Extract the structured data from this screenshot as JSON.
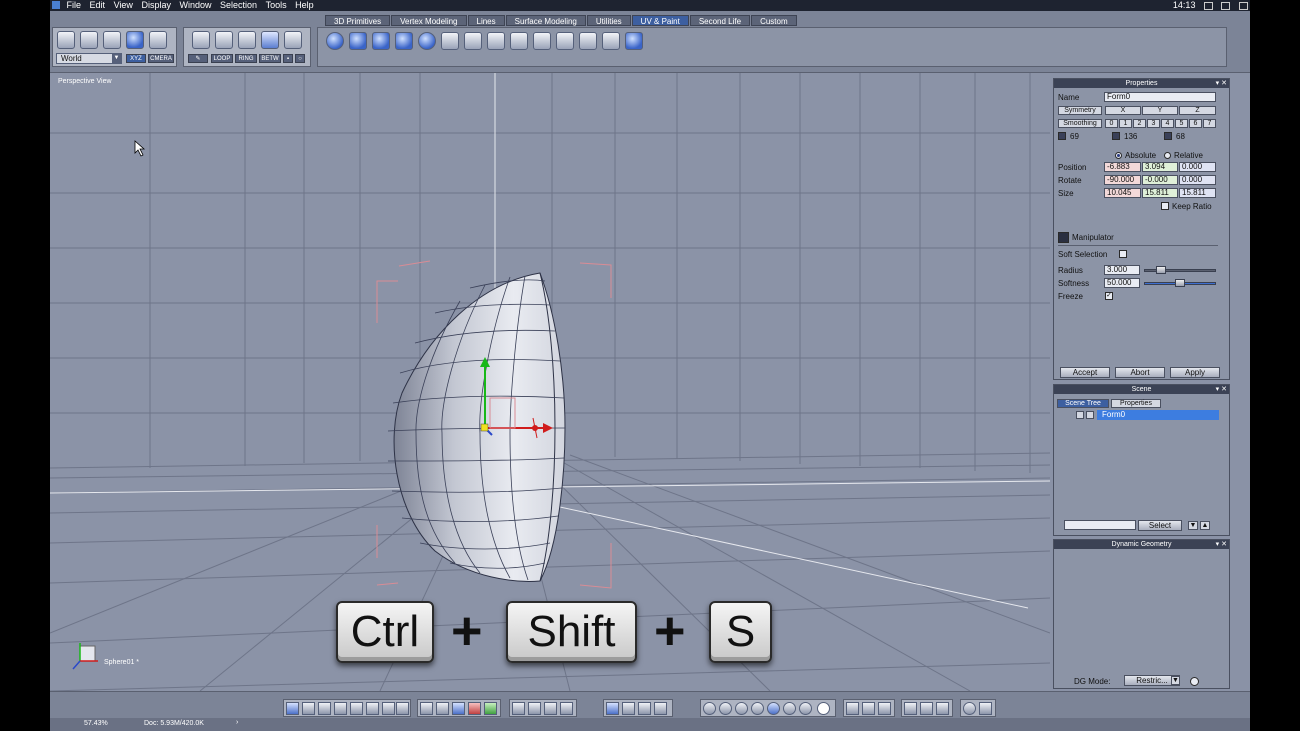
{
  "menubar": {
    "items": [
      "File",
      "Edit",
      "View",
      "Display",
      "Window",
      "Selection",
      "Tools",
      "Help"
    ],
    "clock": "14:13"
  },
  "toolbar": {
    "tabs": [
      "3D Primitives",
      "Vertex Modeling",
      "Lines",
      "Surface Modeling",
      "Utilities",
      "UV & Paint",
      "Second Life",
      "Custom"
    ],
    "active_tab": "UV & Paint",
    "coord_space": "World",
    "xyz_label": "XYZ",
    "camera_label": "CMERA",
    "loop_label": "LOOP",
    "ring_label": "RING",
    "betw_label": "BETW"
  },
  "viewport": {
    "label": "Perspective View",
    "object_label": "Sphere01 *"
  },
  "shortcut": {
    "key1": "Ctrl",
    "plus1": "+",
    "key2": "Shift",
    "plus2": "+",
    "key3": "S"
  },
  "properties": {
    "title": "Properties",
    "name_label": "Name",
    "name_value": "Form0",
    "symmetry_label": "Symmetry",
    "sym_axes": [
      "X",
      "Y",
      "Z"
    ],
    "smoothing_label": "Smoothing",
    "smoothing_levels": [
      "0",
      "1",
      "2",
      "3",
      "4",
      "5",
      "6",
      "7"
    ],
    "counts": [
      "69",
      "136",
      "68"
    ],
    "absolute_label": "Absolute",
    "relative_label": "Relative",
    "position_label": "Position",
    "position": [
      "-6.883",
      "3.094",
      "0.000"
    ],
    "rotate_label": "Rotate",
    "rotate": [
      "-90.000",
      "-0.000",
      "0.000"
    ],
    "size_label": "Size",
    "size": [
      "10.045",
      "15.811",
      "15.811"
    ],
    "keep_ratio_label": "Keep Ratio",
    "manipulator_label": "Manipulator",
    "soft_selection_label": "Soft Selection",
    "radius_label": "Radius",
    "radius_value": "3.000",
    "radius_level": 0.2,
    "softness_label": "Softness",
    "softness_value": "50.000",
    "softness_level": 0.5,
    "freeze_label": "Freeze",
    "freeze_mark": "✓",
    "accept_label": "Accept",
    "abort_label": "Abort",
    "apply_label": "Apply"
  },
  "scene": {
    "title": "Scene",
    "tabs": [
      "Scene Tree",
      "Properties"
    ],
    "items": [
      "Form0"
    ],
    "select_label": "Select"
  },
  "dynamic_geometry": {
    "title": "Dynamic Geometry",
    "dg_mode_label": "DG Mode:",
    "dg_mode_value": "Restric..."
  },
  "status": {
    "zoom": "57.43%",
    "doc": "Doc: 5.93M/420.0K"
  },
  "colors": {
    "accent": "#3d5fa0",
    "viewport_bg": "#8b93a7",
    "x_axis": "#d01c1c",
    "y_axis": "#18b818",
    "z_axis": "#2b49c9"
  }
}
